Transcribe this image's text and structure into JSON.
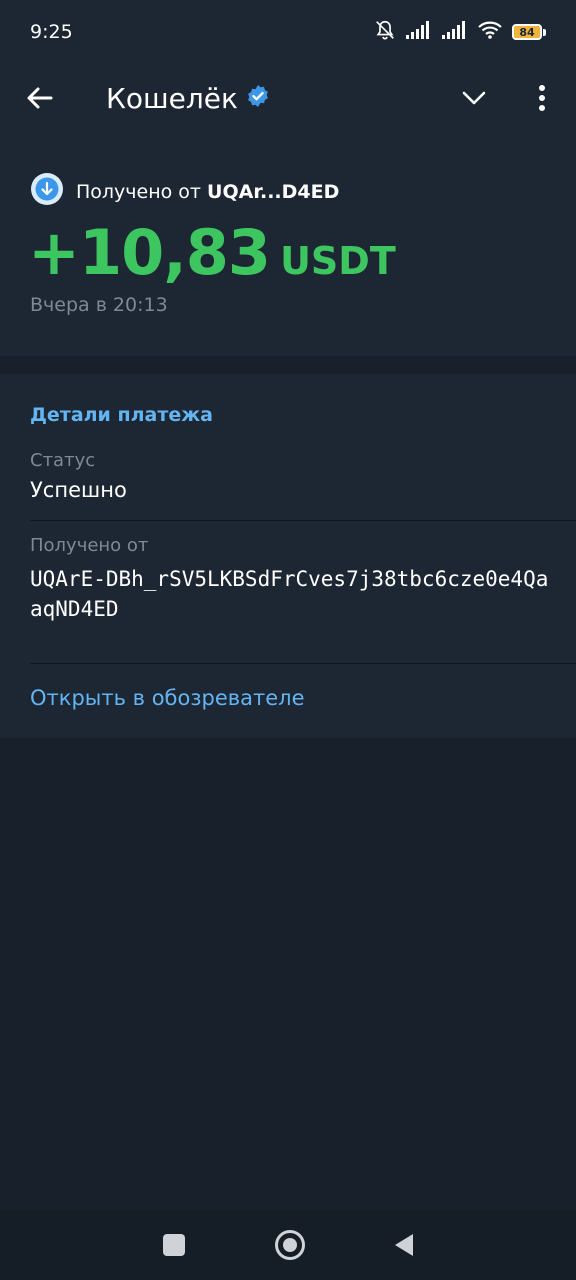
{
  "status_bar": {
    "time": "9:25",
    "battery": "84",
    "icons": [
      "bell-off-icon",
      "signal-icon",
      "signal-icon",
      "wifi-icon",
      "battery-icon"
    ]
  },
  "app_bar": {
    "title": "Кошелёк",
    "verified": true
  },
  "transaction": {
    "from_prefix": "Получено от",
    "from_address_short": "UQAr...D4ED",
    "amount": "+10,83",
    "currency": "USDT",
    "date": "Вчера в 20:13",
    "amount_color": "#3dc660"
  },
  "details": {
    "title": "Детали платежа",
    "status_label": "Статус",
    "status_value": "Успешно",
    "from_label": "Получено от",
    "from_address": "UQArE-DBh_rSV5LKBSdFrCves7j38tbc6cze0e4QaaqND4ED",
    "explorer_link": "Открыть в обозревателе",
    "accent_color": "#64b4f2"
  }
}
